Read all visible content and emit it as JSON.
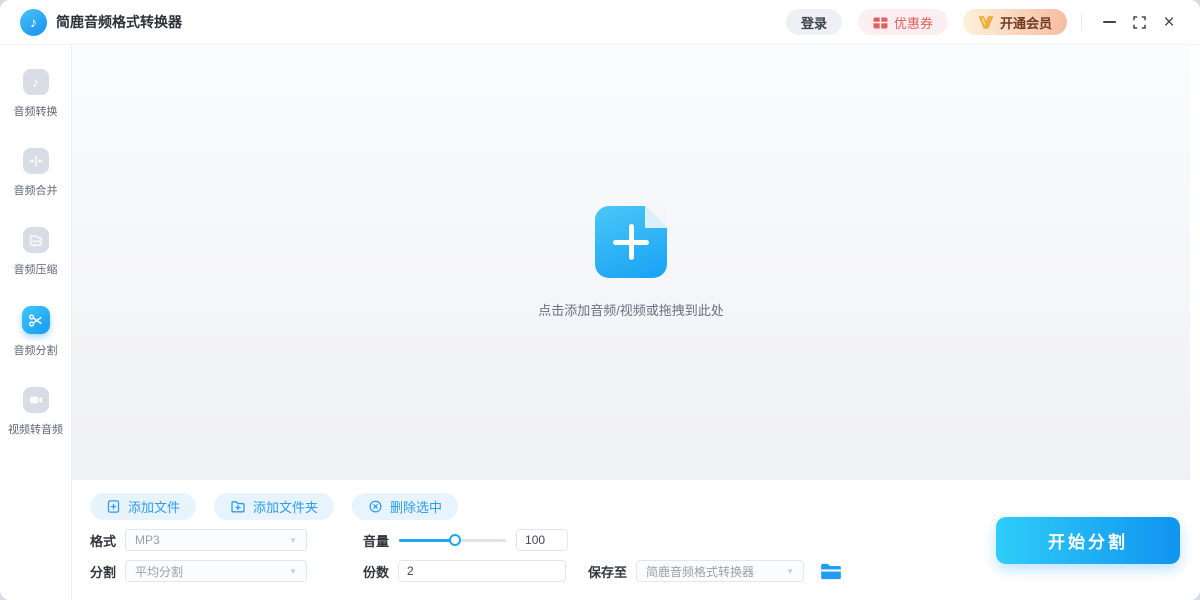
{
  "titlebar": {
    "app_title": "简鹿音频格式转换器",
    "login": "登录",
    "coupon": "优惠券",
    "vip": "开通会员"
  },
  "sidebar": {
    "items": [
      {
        "label": "音频转换",
        "icon": "music-note-icon",
        "active": false
      },
      {
        "label": "音频合并",
        "icon": "merge-arrows-icon",
        "active": false
      },
      {
        "label": "音频压缩",
        "icon": "compress-file-icon",
        "active": false
      },
      {
        "label": "音频分割",
        "icon": "scissors-icon",
        "active": true
      },
      {
        "label": "视频转音频",
        "icon": "video-camera-icon",
        "active": false
      }
    ]
  },
  "dropzone": {
    "hint": "点击添加音频/视频或拖拽到此处"
  },
  "toolbar": {
    "add_file": "添加文件",
    "add_folder": "添加文件夹",
    "delete_selected": "删除选中"
  },
  "controls": {
    "format_label": "格式",
    "format_value": "MP3",
    "volume_label": "音量",
    "volume_value": "100",
    "split_label": "分割",
    "split_value": "平均分割",
    "count_label": "份数",
    "count_value": "2",
    "save_label": "保存至",
    "save_value": "简鹿音频格式转换器"
  },
  "action": {
    "start_split": "开始分割"
  },
  "icons": {
    "note": "♪",
    "close": "×",
    "dropdown_arrow": "▼"
  },
  "colors": {
    "accent": "#1fa6f4",
    "start_gradient_from": "#2fcdf8",
    "start_gradient_to": "#1094f0",
    "pill_bg": "#e7f3fd",
    "pill_text": "#2e9bf5",
    "coupon_red": "#e25f5f",
    "vip_text": "#703a22",
    "vip_gradient_from": "#fcf1d8",
    "vip_gradient_to": "#f7bda4"
  }
}
